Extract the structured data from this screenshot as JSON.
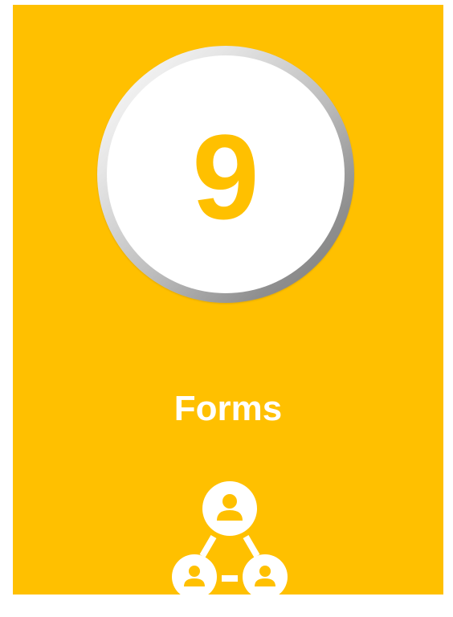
{
  "card": {
    "count": "9",
    "label": "Forms",
    "icon": "user-network-icon"
  },
  "colors": {
    "card_background": "#FFC000",
    "number": "#FFC000",
    "label": "#FFFFFF"
  }
}
